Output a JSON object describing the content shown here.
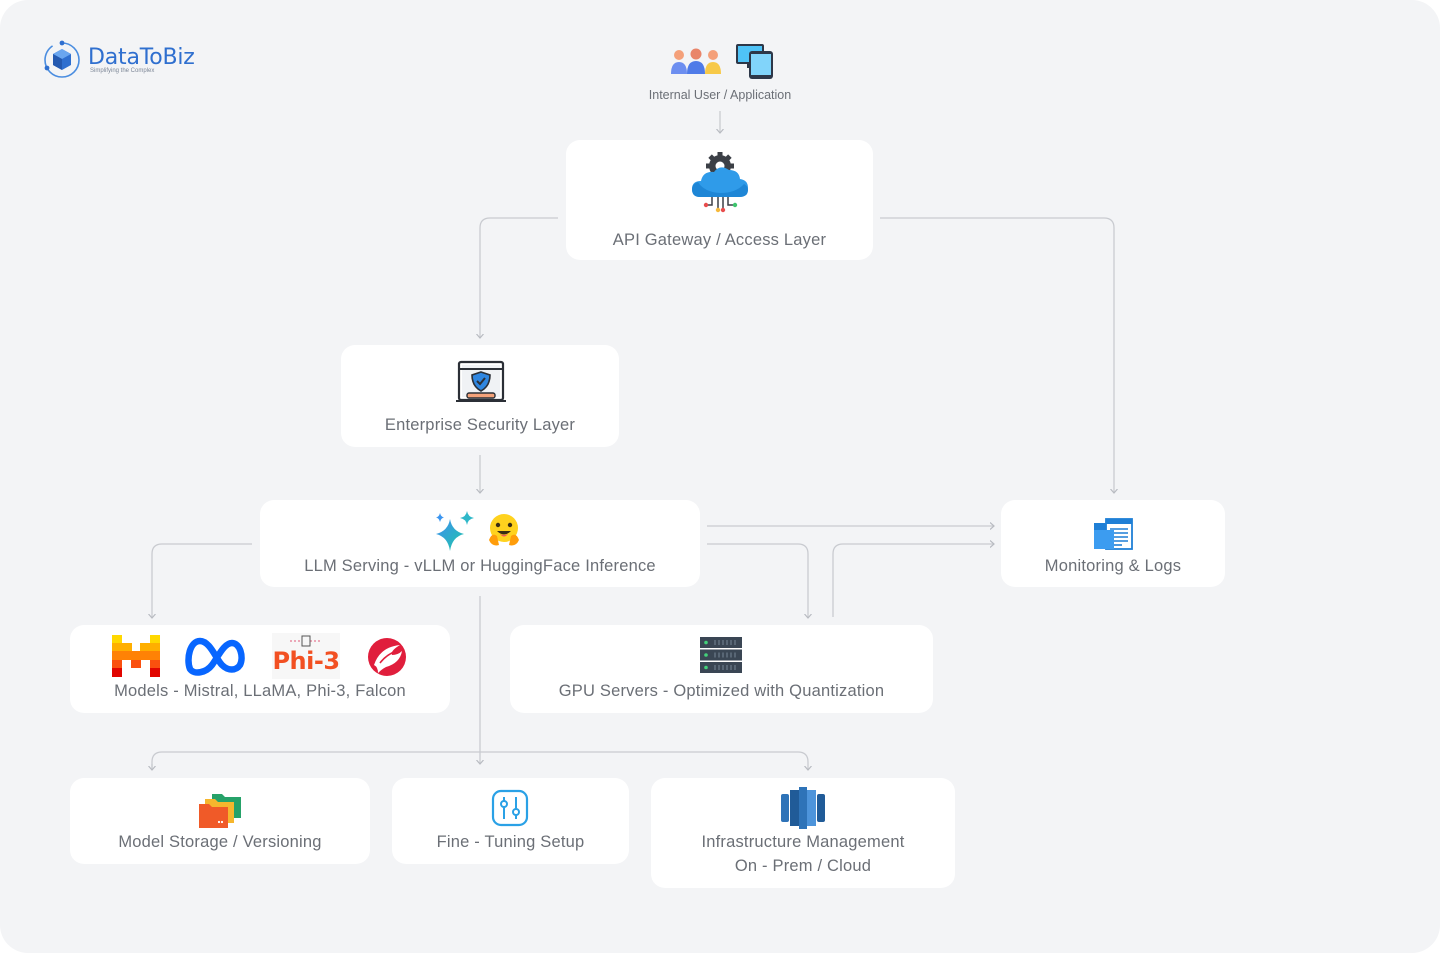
{
  "brand": {
    "name": "DataToBiz",
    "tagline": "Simplifying the Complex",
    "color": "#2f6fcf"
  },
  "top": {
    "label": "Internal User / Application",
    "icons": [
      "users-group-icon",
      "devices-icon"
    ]
  },
  "nodes": {
    "api_gateway": {
      "label": "API Gateway / Access Layer",
      "icon": "cloud-gear-icon"
    },
    "security": {
      "label": "Enterprise Security Layer",
      "icon": "shield-window-icon"
    },
    "llm_serving": {
      "label": "LLM Serving - vLLM or HuggingFace Inference",
      "icons": [
        "sparkles-icon",
        "hugging-face-icon"
      ]
    },
    "monitoring": {
      "label": "Monitoring & Logs",
      "icon": "folder-document-icon"
    },
    "models": {
      "label": "Models - Mistral, LLaMA, Phi-3, Falcon",
      "icons": [
        "mistral-logo-icon",
        "meta-logo-icon",
        "phi3-logo-icon",
        "falcon-logo-icon"
      ],
      "phi3_text": "Phi-3"
    },
    "gpu": {
      "label": "GPU Servers - Optimized with Quantization",
      "icon": "server-rack-icon"
    },
    "storage": {
      "label": "Model Storage / Versioning",
      "icon": "folders-icon"
    },
    "finetune": {
      "label": "Fine - Tuning Setup",
      "icon": "sliders-icon"
    },
    "infra": {
      "label_line1": "Infrastructure Management",
      "label_line2": "On - Prem / Cloud",
      "icon": "cylinder-stack-icon"
    }
  },
  "colors": {
    "background": "#f3f4f6",
    "card": "#ffffff",
    "text": "#6b6f76",
    "connector": "#c9cbd0"
  }
}
